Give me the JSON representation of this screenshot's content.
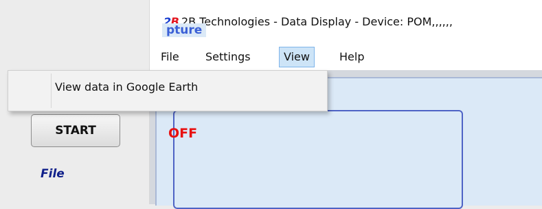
{
  "window": {
    "logo_prefix": "2",
    "logo_suffix": "B",
    "title": "2B Technologies - Data Display - Device: POM,,,,,,"
  },
  "menu": {
    "items": [
      {
        "label": "File"
      },
      {
        "label": "Settings"
      },
      {
        "label": "View"
      },
      {
        "label": "Help"
      }
    ],
    "active": "View"
  },
  "dropdown": {
    "items": [
      {
        "label": "View data in Google Earth"
      }
    ]
  },
  "capture": {
    "group_title_fragment": "pture",
    "start_label": "START",
    "status": "OFF",
    "file_label": "File"
  },
  "colors": {
    "logo_blue": "#1a3fd0",
    "logo_red": "#e3161f",
    "status_off": "#e81010",
    "group_title": "#3a5fd6",
    "file_label": "#10208a",
    "panel_bg": "#dbe9f7",
    "menu_active_bg": "#cde4f7"
  }
}
